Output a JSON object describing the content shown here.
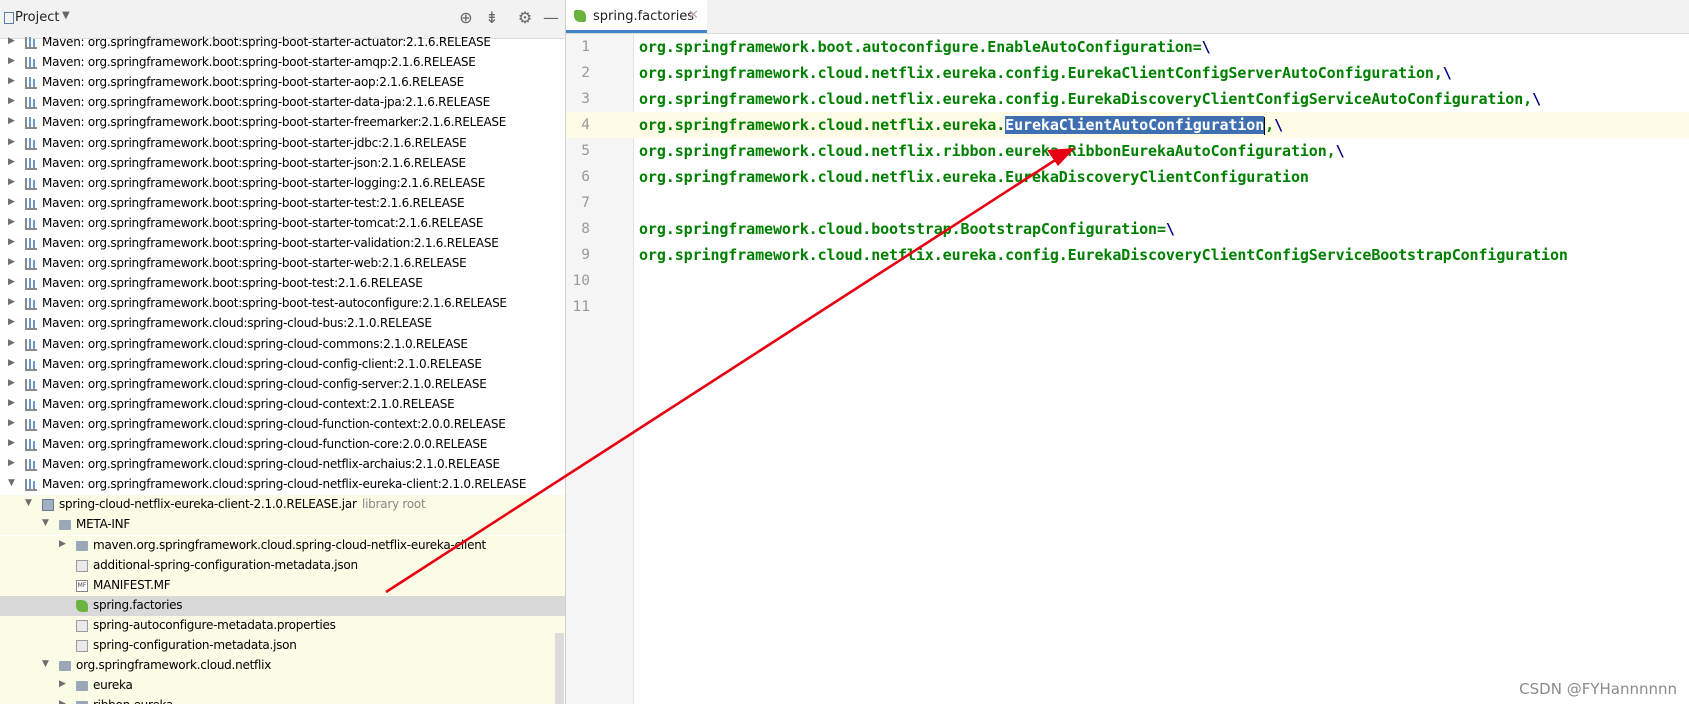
{
  "project_panel": {
    "title": "Project",
    "dropdown_icon": "chevron-down-icon",
    "tools": [
      "locate-icon",
      "collapse-all-icon",
      "gear-icon",
      "minimize-icon"
    ]
  },
  "tree": [
    {
      "label": "Maven: org.springframework.boot:spring-boot-starter-actuator:2.1.6.RELEASE",
      "level": 0,
      "icon": "library",
      "expandable": true,
      "expanded": false
    },
    {
      "label": "Maven: org.springframework.boot:spring-boot-starter-amqp:2.1.6.RELEASE",
      "level": 0,
      "icon": "library",
      "expandable": true,
      "expanded": false
    },
    {
      "label": "Maven: org.springframework.boot:spring-boot-starter-aop:2.1.6.RELEASE",
      "level": 0,
      "icon": "library",
      "expandable": true,
      "expanded": false
    },
    {
      "label": "Maven: org.springframework.boot:spring-boot-starter-data-jpa:2.1.6.RELEASE",
      "level": 0,
      "icon": "library",
      "expandable": true,
      "expanded": false
    },
    {
      "label": "Maven: org.springframework.boot:spring-boot-starter-freemarker:2.1.6.RELEASE",
      "level": 0,
      "icon": "library",
      "expandable": true,
      "expanded": false
    },
    {
      "label": "Maven: org.springframework.boot:spring-boot-starter-jdbc:2.1.6.RELEASE",
      "level": 0,
      "icon": "library",
      "expandable": true,
      "expanded": false
    },
    {
      "label": "Maven: org.springframework.boot:spring-boot-starter-json:2.1.6.RELEASE",
      "level": 0,
      "icon": "library",
      "expandable": true,
      "expanded": false
    },
    {
      "label": "Maven: org.springframework.boot:spring-boot-starter-logging:2.1.6.RELEASE",
      "level": 0,
      "icon": "library",
      "expandable": true,
      "expanded": false
    },
    {
      "label": "Maven: org.springframework.boot:spring-boot-starter-test:2.1.6.RELEASE",
      "level": 0,
      "icon": "library",
      "expandable": true,
      "expanded": false
    },
    {
      "label": "Maven: org.springframework.boot:spring-boot-starter-tomcat:2.1.6.RELEASE",
      "level": 0,
      "icon": "library",
      "expandable": true,
      "expanded": false
    },
    {
      "label": "Maven: org.springframework.boot:spring-boot-starter-validation:2.1.6.RELEASE",
      "level": 0,
      "icon": "library",
      "expandable": true,
      "expanded": false
    },
    {
      "label": "Maven: org.springframework.boot:spring-boot-starter-web:2.1.6.RELEASE",
      "level": 0,
      "icon": "library",
      "expandable": true,
      "expanded": false
    },
    {
      "label": "Maven: org.springframework.boot:spring-boot-test:2.1.6.RELEASE",
      "level": 0,
      "icon": "library",
      "expandable": true,
      "expanded": false
    },
    {
      "label": "Maven: org.springframework.boot:spring-boot-test-autoconfigure:2.1.6.RELEASE",
      "level": 0,
      "icon": "library",
      "expandable": true,
      "expanded": false
    },
    {
      "label": "Maven: org.springframework.cloud:spring-cloud-bus:2.1.0.RELEASE",
      "level": 0,
      "icon": "library",
      "expandable": true,
      "expanded": false
    },
    {
      "label": "Maven: org.springframework.cloud:spring-cloud-commons:2.1.0.RELEASE",
      "level": 0,
      "icon": "library",
      "expandable": true,
      "expanded": false
    },
    {
      "label": "Maven: org.springframework.cloud:spring-cloud-config-client:2.1.0.RELEASE",
      "level": 0,
      "icon": "library",
      "expandable": true,
      "expanded": false
    },
    {
      "label": "Maven: org.springframework.cloud:spring-cloud-config-server:2.1.0.RELEASE",
      "level": 0,
      "icon": "library",
      "expandable": true,
      "expanded": false
    },
    {
      "label": "Maven: org.springframework.cloud:spring-cloud-context:2.1.0.RELEASE",
      "level": 0,
      "icon": "library",
      "expandable": true,
      "expanded": false
    },
    {
      "label": "Maven: org.springframework.cloud:spring-cloud-function-context:2.0.0.RELEASE",
      "level": 0,
      "icon": "library",
      "expandable": true,
      "expanded": false
    },
    {
      "label": "Maven: org.springframework.cloud:spring-cloud-function-core:2.0.0.RELEASE",
      "level": 0,
      "icon": "library",
      "expandable": true,
      "expanded": false
    },
    {
      "label": "Maven: org.springframework.cloud:spring-cloud-netflix-archaius:2.1.0.RELEASE",
      "level": 0,
      "icon": "library",
      "expandable": true,
      "expanded": false
    },
    {
      "label": "Maven: org.springframework.cloud:spring-cloud-netflix-eureka-client:2.1.0.RELEASE",
      "level": 0,
      "icon": "library",
      "expandable": true,
      "expanded": true
    },
    {
      "label": "spring-cloud-netflix-eureka-client-2.1.0.RELEASE.jar",
      "suffix": "library root",
      "level": 1,
      "icon": "jar",
      "expandable": true,
      "expanded": true
    },
    {
      "label": "META-INF",
      "level": 2,
      "icon": "folder",
      "expandable": true,
      "expanded": true
    },
    {
      "label": "maven.org.springframework.cloud.spring-cloud-netflix-eureka-client",
      "level": 3,
      "icon": "folder",
      "expandable": true,
      "expanded": false
    },
    {
      "label": "additional-spring-configuration-metadata.json",
      "level": 3,
      "icon": "json-file",
      "expandable": false
    },
    {
      "label": "MANIFEST.MF",
      "level": 3,
      "icon": "manifest-file",
      "expandable": false
    },
    {
      "label": "spring.factories",
      "level": 3,
      "icon": "spring-factories-file",
      "expandable": false,
      "selected": true
    },
    {
      "label": "spring-autoconfigure-metadata.properties",
      "level": 3,
      "icon": "properties-file",
      "expandable": false
    },
    {
      "label": "spring-configuration-metadata.json",
      "level": 3,
      "icon": "json-file",
      "expandable": false
    },
    {
      "label": "org.springframework.cloud.netflix",
      "level": 2,
      "icon": "package",
      "expandable": true,
      "expanded": true
    },
    {
      "label": "eureka",
      "level": 3,
      "icon": "package",
      "expandable": true,
      "expanded": false
    },
    {
      "label": "ribbon.eureka",
      "level": 3,
      "icon": "package",
      "expandable": true,
      "expanded": false
    }
  ],
  "editor": {
    "tab": {
      "label": "spring.factories",
      "icon": "spring-factories-icon",
      "close_icon": "close-icon"
    },
    "current_line": 4,
    "lines": [
      {
        "num": "1",
        "text": "org.springframework.boot.autoconfigure.EnableAutoConfiguration=",
        "cont": "\\"
      },
      {
        "num": "2",
        "text": "org.springframework.cloud.netflix.eureka.config.EurekaClientConfigServerAutoConfiguration,",
        "cont": "\\"
      },
      {
        "num": "3",
        "text": "org.springframework.cloud.netflix.eureka.config.EurekaDiscoveryClientConfigServiceAutoConfiguration,",
        "cont": "\\"
      },
      {
        "num": "4",
        "text": "org.springframework.cloud.netflix.eureka.",
        "selected": "EurekaClientAutoConfiguration",
        "after": ",",
        "cont": "\\"
      },
      {
        "num": "5",
        "text": "org.springframework.cloud.netflix.ribbon.eureka.RibbonEurekaAutoConfiguration,",
        "cont": "\\"
      },
      {
        "num": "6",
        "text": "org.springframework.cloud.netflix.eureka.EurekaDiscoveryClientConfiguration",
        "cont": ""
      },
      {
        "num": "7",
        "text": "",
        "cont": ""
      },
      {
        "num": "8",
        "text": "org.springframework.cloud.bootstrap.BootstrapConfiguration=",
        "cont": "\\"
      },
      {
        "num": "9",
        "text": "org.springframework.cloud.netflix.eureka.config.EurekaDiscoveryClientConfigServiceBootstrapConfiguration",
        "cont": ""
      },
      {
        "num": "10",
        "text": "",
        "cont": ""
      },
      {
        "num": "11",
        "text": "",
        "cont": ""
      }
    ]
  },
  "watermark": "CSDN @FYHannnnnn",
  "colors": {
    "code_green": "#008000",
    "continuation_navy": "#000080",
    "selection": "#3f6fb0",
    "annotation_arrow": "#e60012",
    "jar_highlight": "#fbfbe6"
  }
}
